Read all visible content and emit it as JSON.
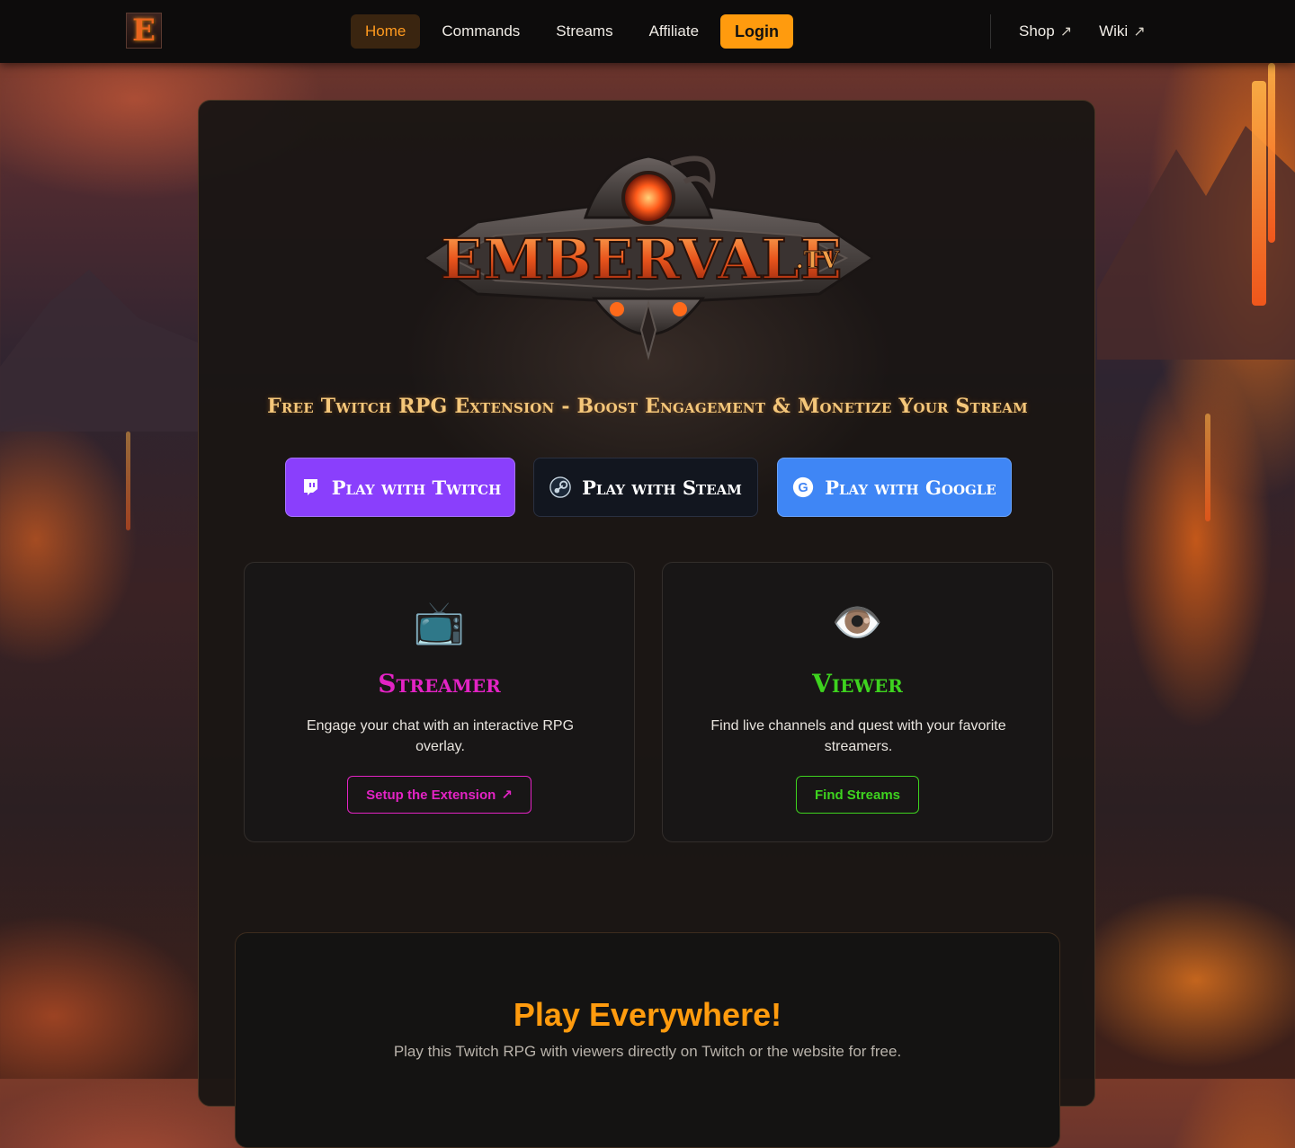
{
  "nav": {
    "logo_letter": "E",
    "links": [
      {
        "label": "Home"
      },
      {
        "label": "Commands"
      },
      {
        "label": "Streams"
      },
      {
        "label": "Affiliate"
      }
    ],
    "login_label": "Login",
    "external": [
      {
        "label": "Shop"
      },
      {
        "label": "Wiki"
      }
    ],
    "external_arrow": "↗"
  },
  "hero": {
    "logo_text": "EMBERVALE",
    "logo_suffix": ".TV",
    "tagline": "Free Twitch RPG Extension - Boost Engagement & Monetize Your Stream",
    "buttons": [
      {
        "label": "Play with Twitch",
        "icon": "twitch-icon",
        "color": "#8a3ffc"
      },
      {
        "label": "Play with Steam",
        "icon": "steam-icon",
        "color": "#12161f"
      },
      {
        "label": "Play with Google",
        "icon": "google-icon",
        "color": "#3f86f5"
      }
    ]
  },
  "roles": {
    "streamer": {
      "emoji": "📺",
      "title": "Streamer",
      "description": "Engage your chat with an interactive RPG overlay.",
      "button_label": "Setup the Extension",
      "color": "#e323c4"
    },
    "viewer": {
      "emoji": "👁️",
      "title": "Viewer",
      "description": "Find live channels and quest with your favorite streamers.",
      "button_label": "Find Streams",
      "color": "#3ed31f"
    }
  },
  "play_everywhere": {
    "title": "Play Everywhere!",
    "subtitle": "Play this Twitch RPG with viewers directly on Twitch or the website for free."
  },
  "colors": {
    "accent": "#ff9b0e",
    "nav_bg": "#0d0c0c"
  }
}
